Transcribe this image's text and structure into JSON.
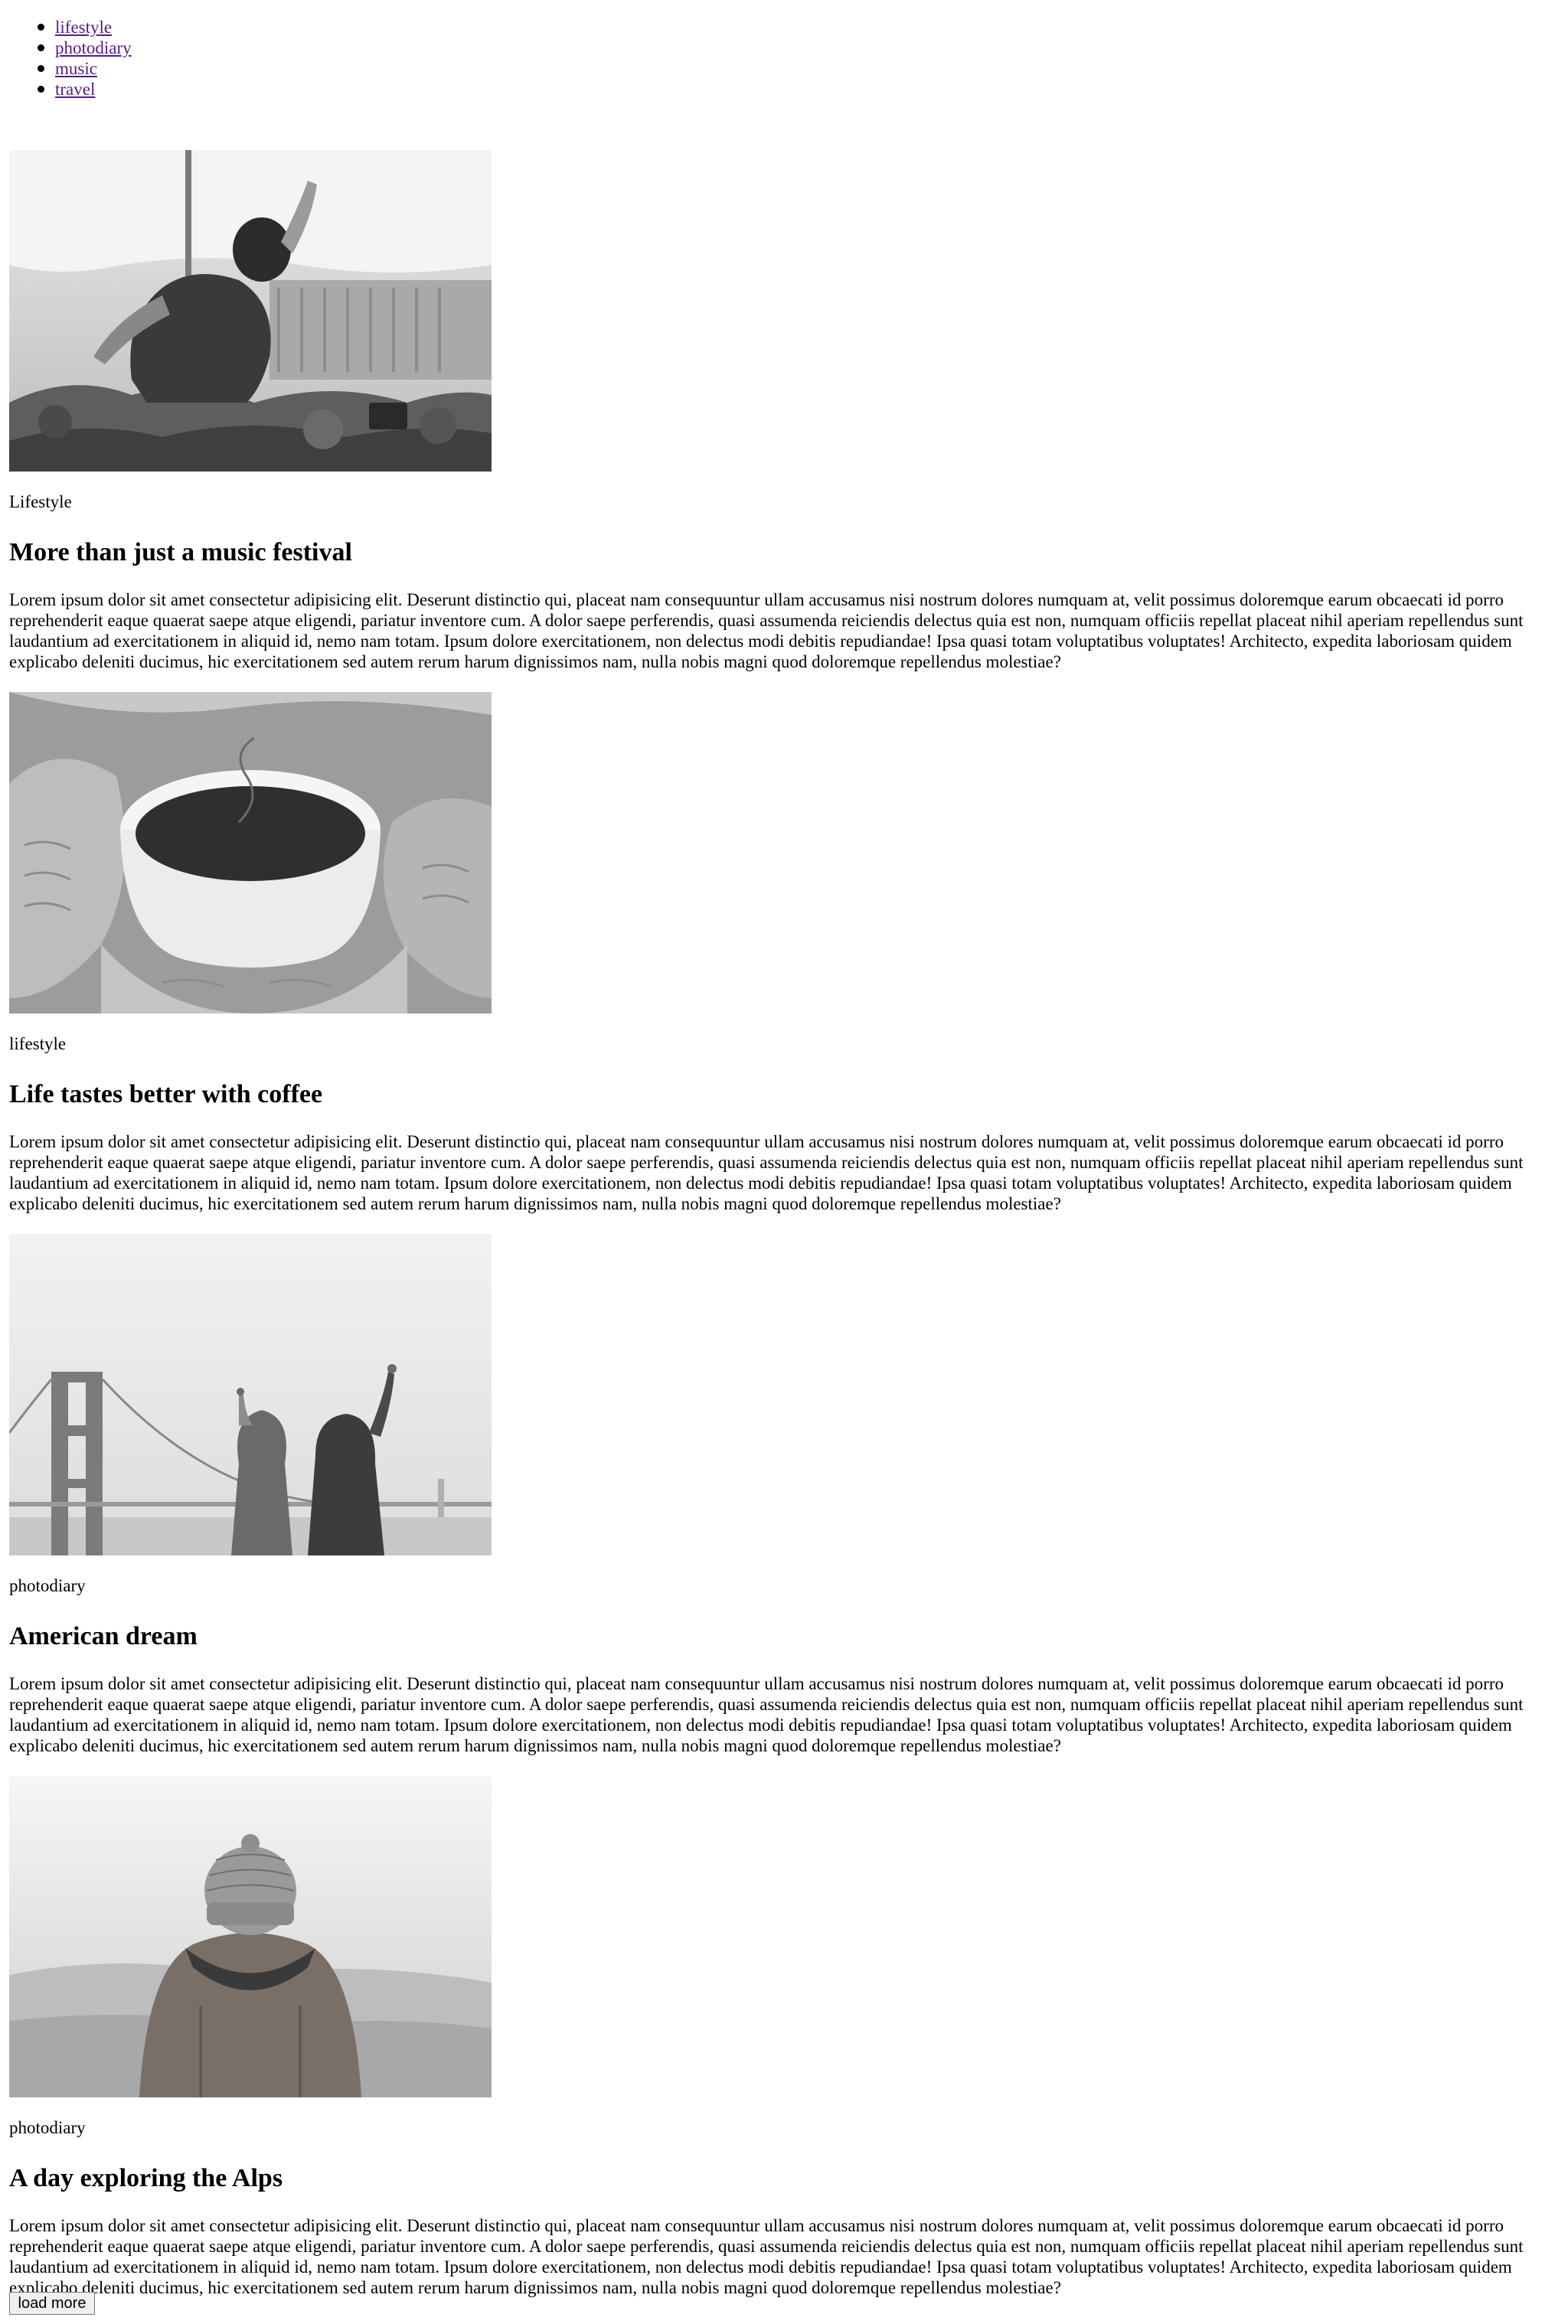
{
  "nav": {
    "items": [
      {
        "label": "lifestyle"
      },
      {
        "label": "photodiary"
      },
      {
        "label": "music"
      },
      {
        "label": "travel"
      }
    ]
  },
  "articles": [
    {
      "category": "Lifestyle",
      "title": "More than just a music festival",
      "body": "Lorem ipsum dolor sit amet consectetur adipisicing elit. Deserunt distinctio qui, placeat nam consequuntur ullam accusamus nisi nostrum dolores numquam at, velit possimus doloremque earum obcaecati id porro reprehenderit eaque quaerat saepe atque eligendi, pariatur inventore cum. A dolor saepe perferendis, quasi assumenda reiciendis delectus quia est non, numquam officiis repellat placeat nihil aperiam repellendus sunt laudantium ad exercitationem in aliquid id, nemo nam totam. Ipsum dolore exercitationem, non delectus modi debitis repudiandae! Ipsa quasi totam voluptatibus voluptates! Architecto, expedita laboriosam quidem explicabo deleniti ducimus, hic exercitationem sed autem rerum harum dignissimos nam, nulla nobis magni quod doloremque repellendus molestiae?"
    },
    {
      "category": "lifestyle",
      "title": "Life tastes better with coffee",
      "body": "Lorem ipsum dolor sit amet consectetur adipisicing elit. Deserunt distinctio qui, placeat nam consequuntur ullam accusamus nisi nostrum dolores numquam at, velit possimus doloremque earum obcaecati id porro reprehenderit eaque quaerat saepe atque eligendi, pariatur inventore cum. A dolor saepe perferendis, quasi assumenda reiciendis delectus quia est non, numquam officiis repellat placeat nihil aperiam repellendus sunt laudantium ad exercitationem in aliquid id, nemo nam totam. Ipsum dolore exercitationem, non delectus modi debitis repudiandae! Ipsa quasi totam voluptatibus voluptates! Architecto, expedita laboriosam quidem explicabo deleniti ducimus, hic exercitationem sed autem rerum harum dignissimos nam, nulla nobis magni quod doloremque repellendus molestiae?"
    },
    {
      "category": "photodiary",
      "title": "American dream",
      "body": "Lorem ipsum dolor sit amet consectetur adipisicing elit. Deserunt distinctio qui, placeat nam consequuntur ullam accusamus nisi nostrum dolores numquam at, velit possimus doloremque earum obcaecati id porro reprehenderit eaque quaerat saepe atque eligendi, pariatur inventore cum. A dolor saepe perferendis, quasi assumenda reiciendis delectus quia est non, numquam officiis repellat placeat nihil aperiam repellendus sunt laudantium ad exercitationem in aliquid id, nemo nam totam. Ipsum dolore exercitationem, non delectus modi debitis repudiandae! Ipsa quasi totam voluptatibus voluptates! Architecto, expedita laboriosam quidem explicabo deleniti ducimus, hic exercitationem sed autem rerum harum dignissimos nam, nulla nobis magni quod doloremque repellendus molestiae?"
    },
    {
      "category": "photodiary",
      "title": "A day exploring the Alps",
      "body": "Lorem ipsum dolor sit amet consectetur adipisicing elit. Deserunt distinctio qui, placeat nam consequuntur ullam accusamus nisi nostrum dolores numquam at, velit possimus doloremque earum obcaecati id porro reprehenderit eaque quaerat saepe atque eligendi, pariatur inventore cum. A dolor saepe perferendis, quasi assumenda reiciendis delectus quia est non, numquam officiis repellat placeat nihil aperiam repellendus sunt laudantium ad exercitationem in aliquid id, nemo nam totam. Ipsum dolore exercitationem, non delectus modi debitis repudiandae! Ipsa quasi totam voluptatibus voluptates! Architecto, expedita laboriosam quidem explicabo deleniti ducimus, hic exercitationem sed autem rerum harum dignissimos nam, nulla nobis magni quod doloremque repellendus molestiae?"
    }
  ],
  "footer": {
    "load_more_label": "load more"
  },
  "colors": {
    "link_visited": "#551a8b",
    "text": "#000000",
    "background": "#ffffff"
  }
}
